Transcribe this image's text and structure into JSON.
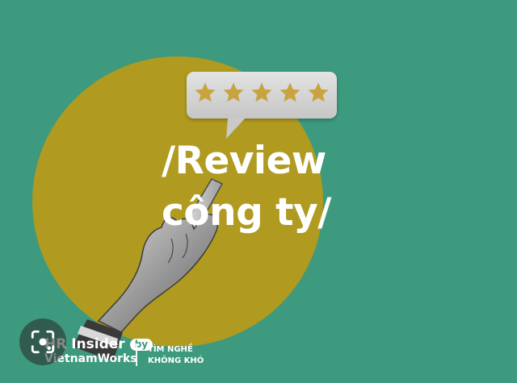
{
  "colors": {
    "background": "#3d9a7e",
    "circle": "#b09a1f",
    "star": "#c9a33e",
    "text": "#ffffff",
    "bubble": "#d6d6d6"
  },
  "rating": {
    "stars": 5,
    "icon": "star-icon"
  },
  "headline": {
    "line1": "/Review",
    "line2": "công ty/"
  },
  "brand": {
    "name_top": "HR Insider",
    "badge": "by",
    "name_bottom": "VietnamWorks"
  },
  "slogan": {
    "line1": "TÌM NGHỀ",
    "line2": "KHÔNG KHÓ"
  },
  "overlay": {
    "icon": "image-search-lens-icon"
  }
}
